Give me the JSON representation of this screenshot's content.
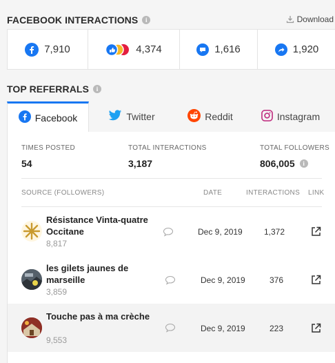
{
  "facebook_interactions": {
    "title": "FACEBOOK INTERACTIONS",
    "download_label": "Download",
    "metrics": [
      {
        "icon": "facebook-icon",
        "value": "7,910"
      },
      {
        "icon": "reactions-icon",
        "value": "4,374"
      },
      {
        "icon": "comment-bubble-icon",
        "value": "1,616"
      },
      {
        "icon": "share-arrow-icon",
        "value": "1,920"
      }
    ]
  },
  "top_referrals": {
    "title": "TOP REFERRALS",
    "tabs": [
      {
        "label": "Facebook",
        "icon": "facebook-icon",
        "active": true
      },
      {
        "label": "Twitter",
        "icon": "twitter-bird-icon"
      },
      {
        "label": "Reddit",
        "icon": "reddit-icon"
      },
      {
        "label": "Instagram",
        "icon": "instagram-icon"
      }
    ],
    "stats": {
      "times_posted_label": "TIMES POSTED",
      "times_posted": "54",
      "total_interactions_label": "TOTAL INTERACTIONS",
      "total_interactions": "3,187",
      "total_followers_label": "TOTAL FOLLOWERS",
      "total_followers": "806,005"
    },
    "table": {
      "headers": {
        "source": "SOURCE (FOLLOWERS)",
        "date": "DATE",
        "interactions": "INTERACTIONS",
        "link": "LINK"
      },
      "rows": [
        {
          "name": "Résistance Vinta-quatre Occitane",
          "followers": "8,817",
          "date": "Dec 9, 2019",
          "interactions": "1,372"
        },
        {
          "name": "les gilets jaunes de marseille",
          "followers": "3,859",
          "date": "Dec 9, 2019",
          "interactions": "376"
        },
        {
          "name": "Touche pas à ma crèche",
          "followers": "9,553",
          "date": "Dec 9, 2019",
          "interactions": "223"
        }
      ]
    }
  },
  "colors": {
    "facebook_blue": "#1877f2",
    "twitter_blue": "#1da1f2",
    "reddit_orange": "#ff4500",
    "instagram": "#c13584"
  }
}
